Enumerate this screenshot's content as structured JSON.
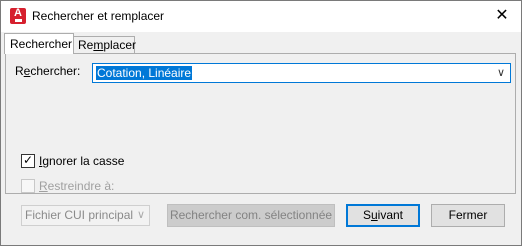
{
  "window": {
    "title": "Rechercher et remplacer"
  },
  "tabs": [
    {
      "label": "Rechercher"
    },
    {
      "label": "Remplacer"
    }
  ],
  "find": {
    "label": "Rechercher:",
    "value": "Cotation, Linéaire"
  },
  "options": {
    "ignore_case": {
      "label": "Ignorer la casse",
      "checked": true
    },
    "restrict": {
      "label": "Restreindre à:",
      "checked": false,
      "enabled": false
    }
  },
  "scope": {
    "value": "Fichier CUI principal"
  },
  "buttons": {
    "search_selected": "Rechercher com. sélectionnée",
    "next": "Suivant",
    "close": "Fermer"
  },
  "icons": {
    "app": "autocad-icon",
    "close": "close-icon",
    "dropdown": "chevron-down-icon",
    "check": "checkmark-icon"
  },
  "colors": {
    "accent": "#0078d7",
    "app_icon": "#d6202e"
  }
}
